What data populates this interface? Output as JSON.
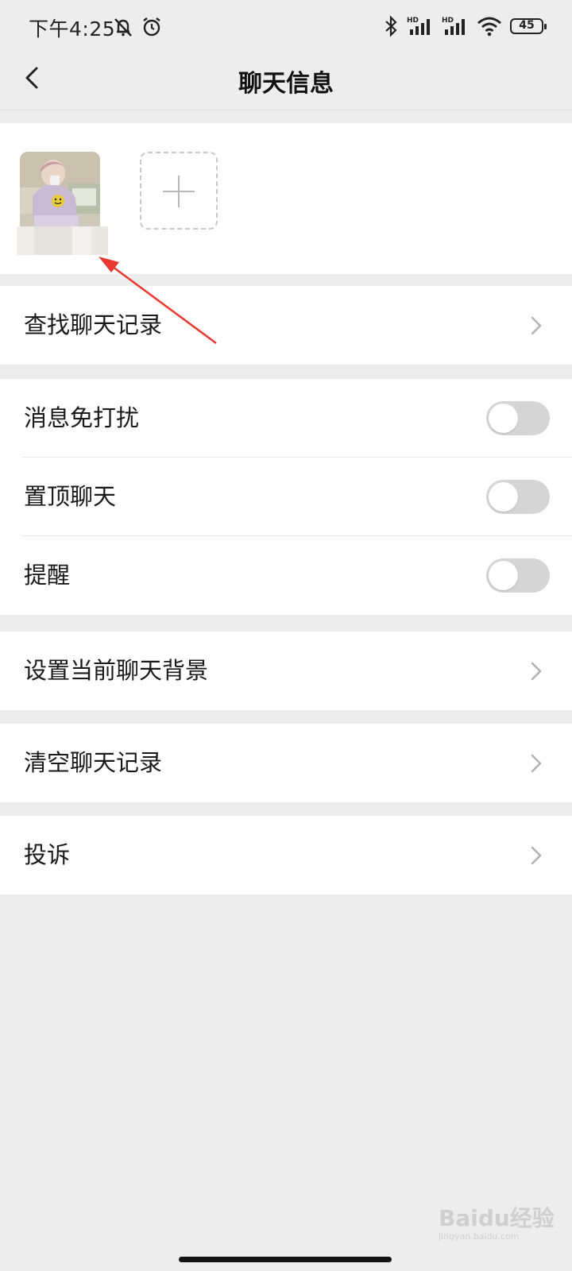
{
  "status_bar": {
    "time": "下午4:25",
    "battery": "45",
    "icons": [
      "mute-bell-icon",
      "alarm-icon",
      "bluetooth-icon",
      "signal-hd-icon",
      "signal-hd-icon",
      "wifi-icon",
      "battery-icon"
    ],
    "hd_label": "HD"
  },
  "nav": {
    "title": "聊天信息",
    "back_icon": "chevron-left-icon"
  },
  "members": {
    "add_icon": "plus-icon"
  },
  "rows": [
    {
      "label": "查找聊天记录",
      "type": "link"
    },
    {
      "label": "消息免打扰",
      "type": "toggle",
      "on": false
    },
    {
      "label": "置顶聊天",
      "type": "toggle",
      "on": false
    },
    {
      "label": "提醒",
      "type": "toggle",
      "on": false
    },
    {
      "label": "设置当前聊天背景",
      "type": "link"
    },
    {
      "label": "清空聊天记录",
      "type": "link"
    },
    {
      "label": "投诉",
      "type": "link"
    }
  ],
  "annotation": {
    "color": "#e8382f"
  },
  "watermark": {
    "text": "Baidu经验",
    "sub": "jingyan.baidu.com"
  }
}
